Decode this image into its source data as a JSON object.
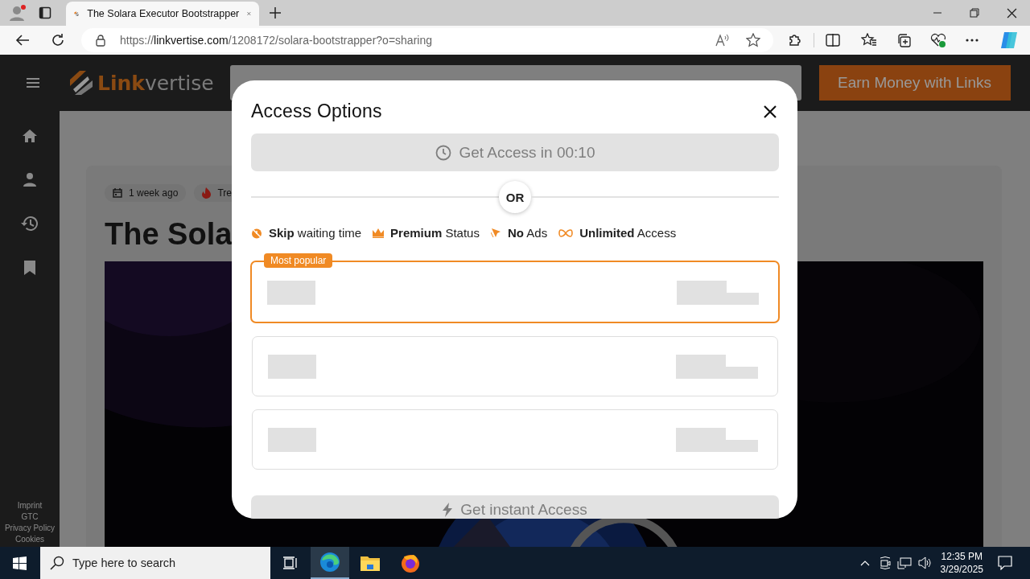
{
  "browser": {
    "tab": {
      "title": "The Solara Executor Bootstrapper",
      "selected": true
    },
    "address": {
      "scheme": "https://",
      "domain": "linkvertise.com",
      "path": "/1208172/solara-bootstrapper?o=sharing"
    }
  },
  "site": {
    "logo": {
      "first": "Link",
      "second": "vertise"
    },
    "earn_button": "Earn Money with Links",
    "footer_links": [
      "Imprint",
      "GTC",
      "Privacy Policy",
      "Cookies"
    ],
    "chips": [
      "1 week ago",
      "Tre"
    ],
    "title": "The Sola"
  },
  "modal": {
    "title": "Access Options",
    "wait_button": {
      "label": "Get Access in 00:10",
      "disabled": true
    },
    "divider": "OR",
    "features": [
      {
        "kind": "skip",
        "text": "**Skip** waiting time"
      },
      {
        "kind": "premium",
        "text": "**Premium** Status"
      },
      {
        "kind": "noads",
        "text": "**No** Ads"
      },
      {
        "kind": "unlimited",
        "text": "**Unlimited** Access"
      }
    ],
    "plans": [
      {
        "selected": true,
        "badge": "Most popular"
      },
      {
        "selected": false
      },
      {
        "selected": false
      }
    ],
    "instant_button": {
      "label": "Get instant Access",
      "disabled": true
    }
  },
  "taskbar": {
    "search": {
      "placeholder": "Type here to search"
    },
    "time": "12:35 PM",
    "date": "3/29/2025"
  }
}
